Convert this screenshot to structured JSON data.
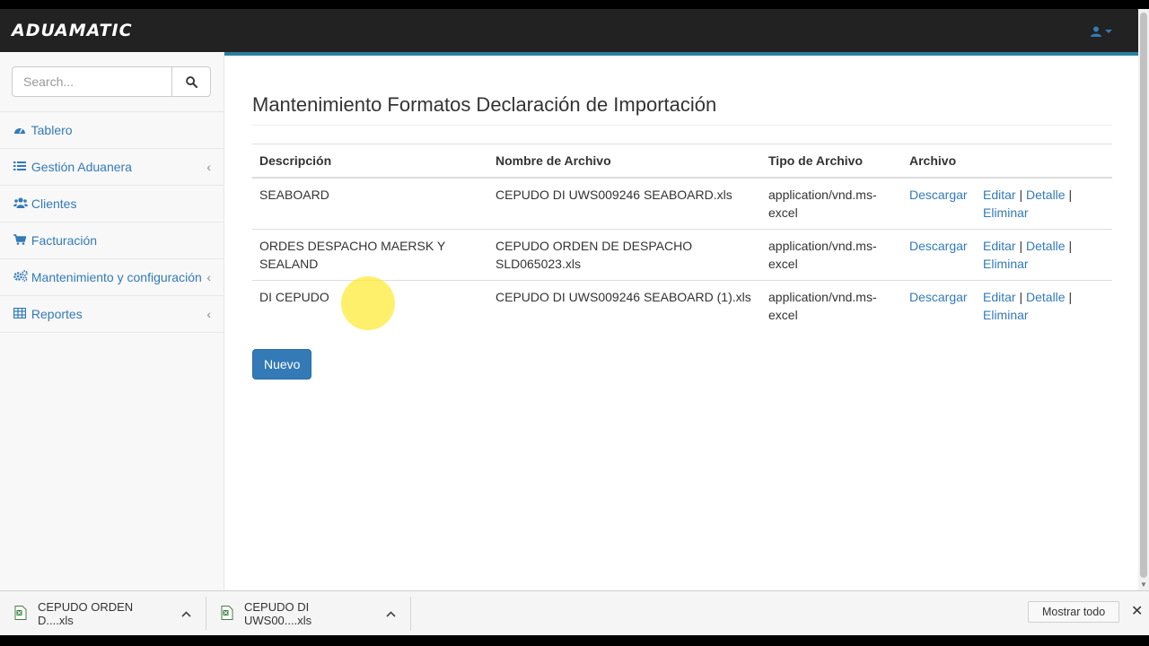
{
  "app": {
    "brand": "ADUAMATIC"
  },
  "header": {
    "user_icon": "user-icon",
    "caret": "caret-down-icon"
  },
  "sidebar": {
    "search": {
      "placeholder": "Search...",
      "value": ""
    },
    "items": [
      {
        "label": "Tablero",
        "icon": "dashboard-icon",
        "has_arrow": false
      },
      {
        "label": "Gestión Aduanera",
        "icon": "list-icon",
        "has_arrow": true
      },
      {
        "label": "Clientes",
        "icon": "users-icon",
        "has_arrow": false
      },
      {
        "label": "Facturación",
        "icon": "cart-icon",
        "has_arrow": false
      },
      {
        "label": "Mantenimiento y configuración",
        "icon": "cogs-icon",
        "has_arrow": true
      },
      {
        "label": "Reportes",
        "icon": "table-icon",
        "has_arrow": true
      }
    ],
    "arrow_glyph": "‹"
  },
  "main": {
    "title": "Mantenimiento Formatos Declaración de Importación",
    "table": {
      "headers": [
        "Descripción",
        "Nombre de Archivo",
        "Tipo de Archivo",
        "Archivo",
        ""
      ],
      "rows": [
        {
          "descripcion": "SEABOARD",
          "nombre": "CEPUDO DI UWS009246 SEABOARD.xls",
          "tipo": "application/vnd.ms-excel",
          "descargar": "Descargar",
          "editar": "Editar",
          "detalle": "Detalle",
          "eliminar": "Eliminar"
        },
        {
          "descripcion": "ORDES DESPACHO MAERSK Y SEALAND",
          "nombre": "CEPUDO ORDEN DE DESPACHO SLD065023.xls",
          "tipo": "application/vnd.ms-excel",
          "descargar": "Descargar",
          "editar": "Editar",
          "detalle": "Detalle",
          "eliminar": "Eliminar"
        },
        {
          "descripcion": "DI CEPUDO",
          "nombre": "CEPUDO DI UWS009246 SEABOARD (1).xls",
          "tipo": "application/vnd.ms-excel",
          "descargar": "Descargar",
          "editar": "Editar",
          "detalle": "Detalle",
          "eliminar": "Eliminar"
        }
      ],
      "separator": "|"
    },
    "new_button": "Nuevo"
  },
  "downloads": {
    "items": [
      {
        "name": "CEPUDO ORDEN D....xls",
        "icon": "excel-file-icon"
      },
      {
        "name": "CEPUDO DI UWS00....xls",
        "icon": "excel-file-icon"
      }
    ],
    "chevron": "^",
    "show_all": "Mostrar todo",
    "close": "✕"
  },
  "colors": {
    "navbar": "#222222",
    "accent": "#2a7f9c",
    "link": "#337ab7",
    "primary_button": "#337ab7",
    "sidebar_bg": "#f8f8f8"
  }
}
